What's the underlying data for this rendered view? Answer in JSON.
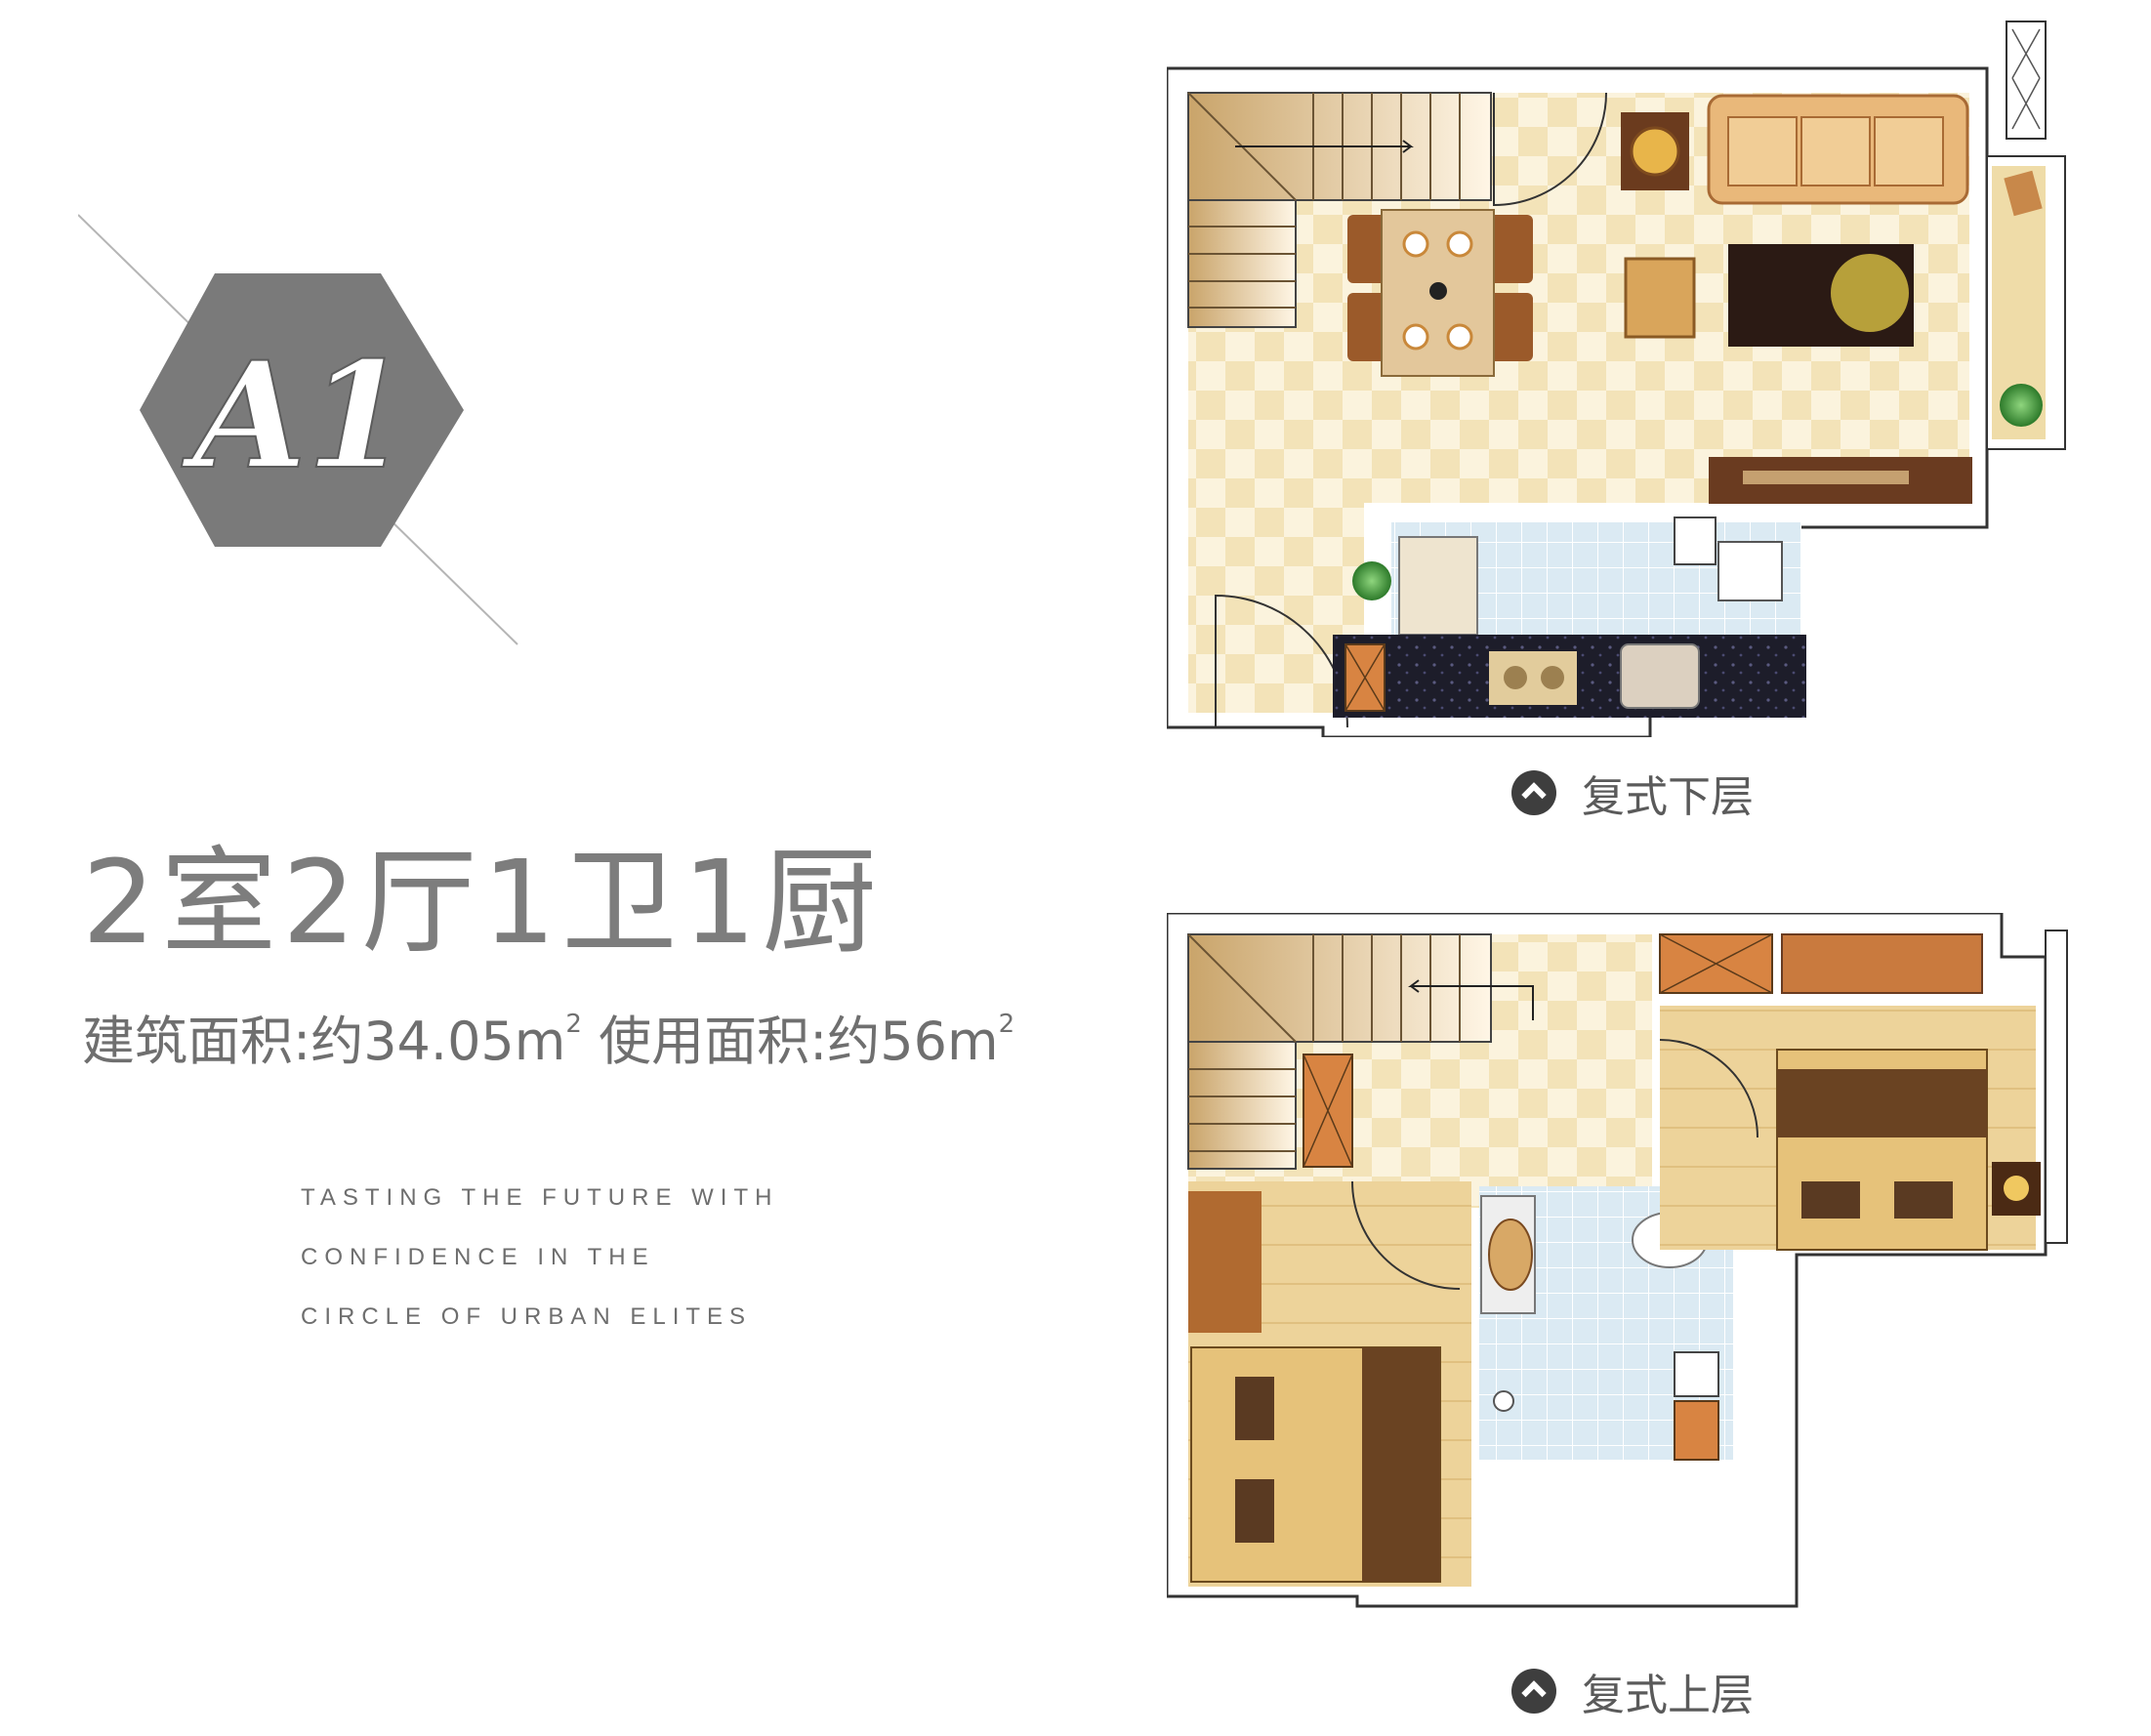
{
  "badge": {
    "code": "A1"
  },
  "layout_title": "2室2厅1卫1厨",
  "area": {
    "built_label": "建筑面积:约34.05m",
    "usable_label": "使用面积:约56m",
    "sup": "2"
  },
  "slogan": [
    "TASTING THE FUTURE WITH",
    "CONFIDENCE IN THE",
    "CIRCLE OF URBAN ELITES"
  ],
  "plans": {
    "lower_caption": "复式下层",
    "upper_caption": "复式上层"
  },
  "colors": {
    "badge_fill": "#7a7a7a",
    "text_gray": "#7d7d7d",
    "floor_checker": "#f5e8c4",
    "floor_light": "#fbf3dd",
    "wood_floor": "#e9cf8f",
    "tile_blue": "#dbeaf3",
    "wall": "#ffffff",
    "wall_line": "#333333"
  }
}
